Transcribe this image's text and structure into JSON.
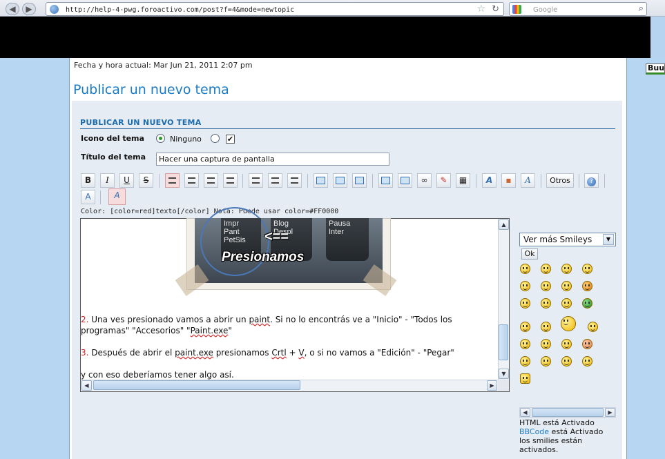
{
  "browser": {
    "url": "http://help-4-pwg.foroactivo.com/post?f=4&mode=newtopic",
    "search_placeholder": "Google",
    "side_tab_label": "Buus"
  },
  "page": {
    "datetime": "Fecha y hora actual: Mar Jun 21, 2011 2:07 pm",
    "title": "Publicar un nuevo tema"
  },
  "form": {
    "header": "PUBLICAR UN NUEVO TEMA",
    "icon_label": "Icono del tema",
    "icon_option_none": "Ninguno",
    "title_label": "Título del tema",
    "title_value": "Hacer una captura de pantalla",
    "color_hint": "Color: [color=red]texto[/color] Nota: Puede usar color=#FF0000"
  },
  "toolbar": {
    "bold": "B",
    "italic": "I",
    "underline": "U",
    "strike": "S",
    "otros": "Otros"
  },
  "editor": {
    "image_keys": [
      "Impr\nPant\nPetSis",
      "Blog\nDespl",
      "Pausa\nInter"
    ],
    "image_arrow": "<==",
    "image_caption": "Presionamos",
    "line1_num": "2.",
    "line1_text_a": " Una ves presionado vamos a abrir un ",
    "line1_paint": "paint",
    "line1_text_b": ". Si no lo encontrás ve a \"Inicio\" - \"Todos los",
    "line2_text_a": "programas\" \"Accesorios\" \"",
    "line2_paint": "Paint.exe",
    "line2_text_b": "\"",
    "line3_num": "3.",
    "line3_text_a": " Después de abrir el ",
    "line3_paint": "paint.exe",
    "line3_text_b": " presionamos ",
    "line3_crtl": "Crtl",
    "line3_text_c": " + ",
    "line3_v": "V",
    "line3_text_d": ", o si no vamos a \"Edición\" - \"Pegar\"",
    "line4_text": "y con eso deberíamos tener algo así."
  },
  "smileys": {
    "select_value": "Ver más Smileys",
    "ok_label": "Ok"
  },
  "status": {
    "html_active": "HTML está Activado",
    "bbcode_link": "BBCode",
    "bbcode_active": " está Activado",
    "smilies_active": "los smilies están activados."
  }
}
